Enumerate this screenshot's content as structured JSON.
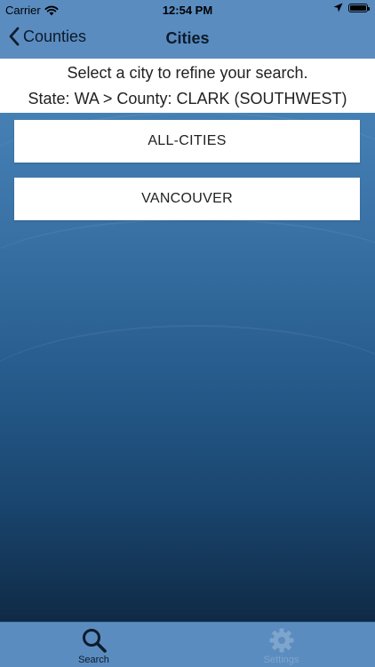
{
  "status_bar": {
    "carrier": "Carrier",
    "time": "12:54 PM"
  },
  "nav": {
    "back_label": "Counties",
    "title": "Cities"
  },
  "header": {
    "instruction": "Select a city to refine your search.",
    "breadcrumb": "State: WA > County: CLARK (SOUTHWEST)"
  },
  "cities": [
    {
      "label": "ALL-CITIES"
    },
    {
      "label": "VANCOUVER"
    }
  ],
  "tab_bar": {
    "tabs": [
      {
        "label": "Search",
        "icon": "search-icon",
        "selected": true
      },
      {
        "label": "Settings",
        "icon": "gear-icon",
        "selected": false
      }
    ]
  },
  "colors": {
    "bar": "#5a8cc0",
    "active_tab": "#0d1b2a",
    "inactive_tab": "#7fa5cc"
  }
}
